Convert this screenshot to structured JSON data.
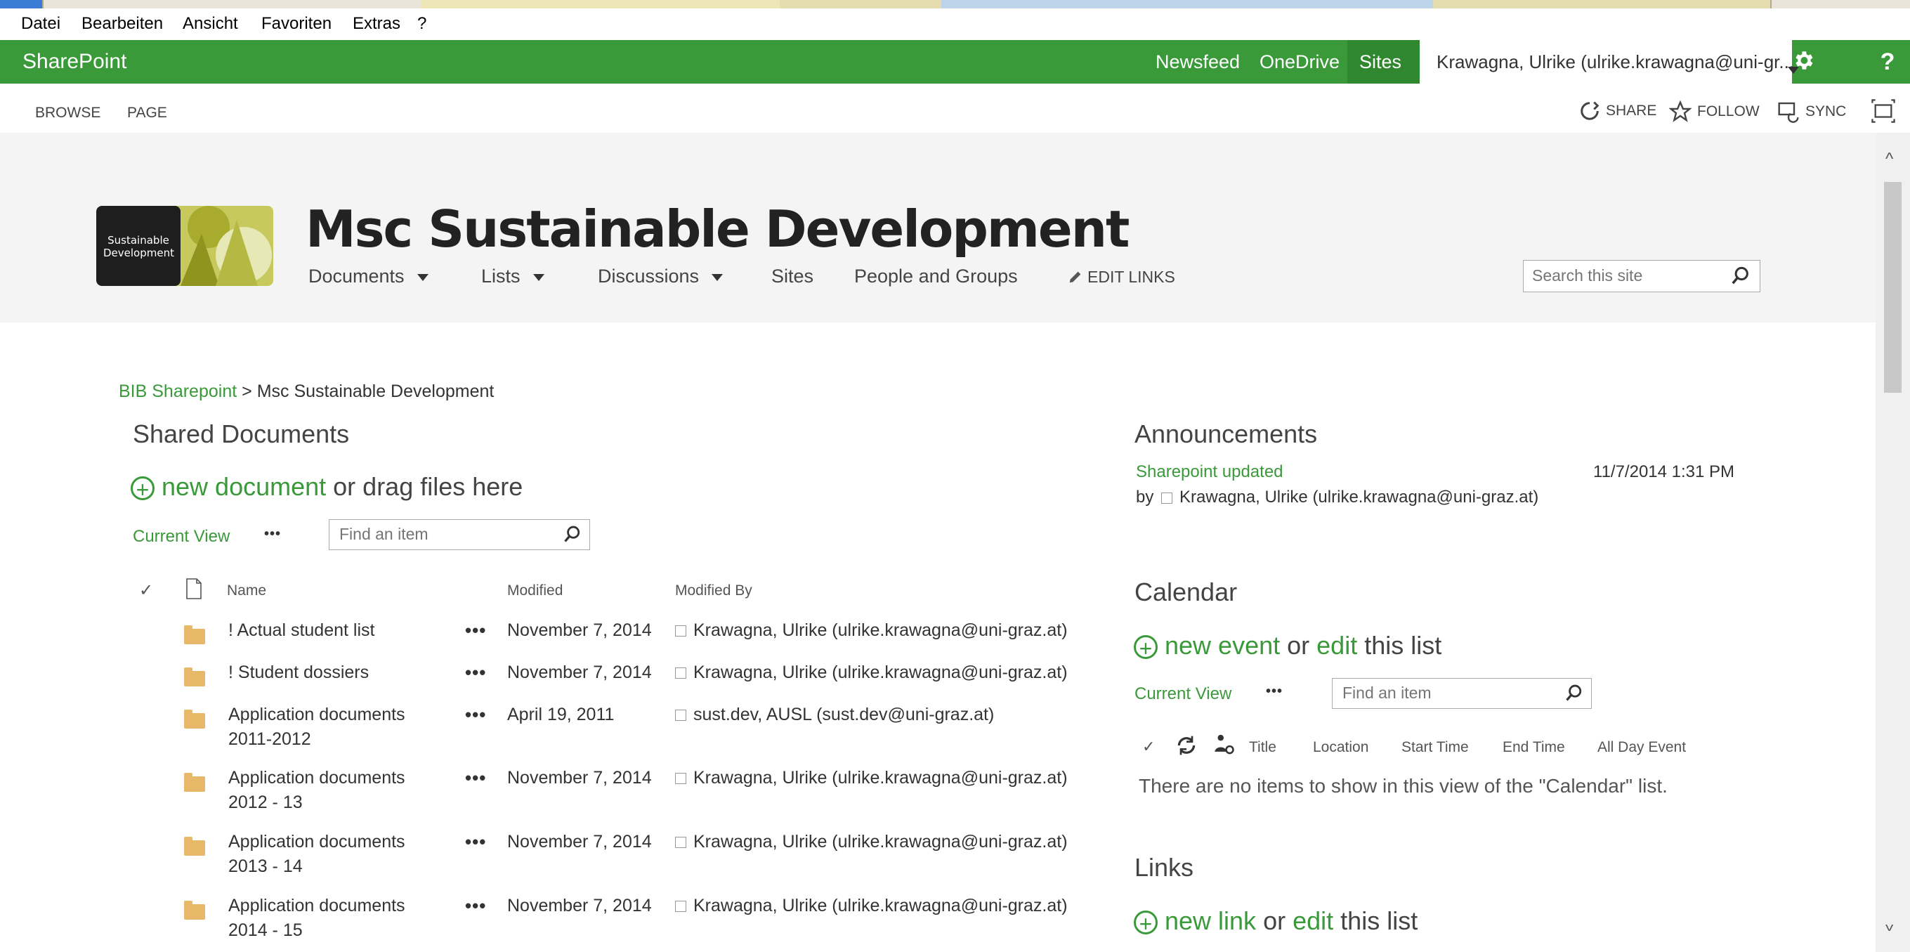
{
  "menubar": {
    "items": [
      "Datei",
      "Bearbeiten",
      "Ansicht",
      "Favoriten",
      "Extras",
      "?"
    ]
  },
  "suitebar": {
    "brand": "SharePoint",
    "nav": [
      "Newsfeed",
      "OneDrive",
      "Sites"
    ],
    "user": "Krawagna, Ulrike (ulrike.krawagna@uni-gr...",
    "settings_icon": "gear-icon",
    "help": "?"
  },
  "ribbon": {
    "tabs": [
      "BROWSE",
      "PAGE"
    ],
    "actions": {
      "share": "SHARE",
      "follow": "FOLLOW",
      "sync": "SYNC"
    }
  },
  "site": {
    "logo_line1": "Sustainable",
    "logo_line2": "Development",
    "title": "Msc Sustainable Development",
    "topnav": [
      "Documents",
      "Lists",
      "Discussions",
      "Sites",
      "People and Groups"
    ],
    "edit_links": "EDIT LINKS",
    "search_placeholder": "Search this site"
  },
  "breadcrumb": {
    "root": "BIB Sharepoint",
    "sep": ">",
    "current": "Msc Sustainable Development"
  },
  "docs": {
    "title": "Shared Documents",
    "new_link": "new document",
    "new_suffix": "or drag files here",
    "current_view": "Current View",
    "more": "•••",
    "find_placeholder": "Find an item",
    "columns": {
      "name": "Name",
      "modified": "Modified",
      "modified_by": "Modified By"
    },
    "rows": [
      {
        "name1": "! Actual student list",
        "name2": "",
        "modified": "November 7, 2014",
        "by": "Krawagna, Ulrike (ulrike.krawagna@uni-graz.at)"
      },
      {
        "name1": "! Student dossiers",
        "name2": "",
        "modified": "November 7, 2014",
        "by": "Krawagna, Ulrike (ulrike.krawagna@uni-graz.at)"
      },
      {
        "name1": "Application documents",
        "name2": "2011-2012",
        "modified": "April 19, 2011",
        "by": "sust.dev, AUSL (sust.dev@uni-graz.at)"
      },
      {
        "name1": "Application documents",
        "name2": "2012 - 13",
        "modified": "November 7, 2014",
        "by": "Krawagna, Ulrike (ulrike.krawagna@uni-graz.at)"
      },
      {
        "name1": "Application documents",
        "name2": "2013 - 14",
        "modified": "November 7, 2014",
        "by": "Krawagna, Ulrike (ulrike.krawagna@uni-graz.at)"
      },
      {
        "name1": "Application documents",
        "name2": "2014 - 15",
        "modified": "November 7, 2014",
        "by": "Krawagna, Ulrike (ulrike.krawagna@uni-graz.at)"
      }
    ]
  },
  "announcements": {
    "title": "Announcements",
    "item_title": "Sharepoint updated",
    "item_date": "11/7/2014 1:31 PM",
    "by_label": "by",
    "by_name": "Krawagna, Ulrike (ulrike.krawagna@uni-graz.at)"
  },
  "calendar": {
    "title": "Calendar",
    "new_link": "new event",
    "or": "or",
    "edit_link": "edit",
    "suffix": "this list",
    "current_view": "Current View",
    "more": "•••",
    "find_placeholder": "Find an item",
    "columns": [
      "Title",
      "Location",
      "Start Time",
      "End Time",
      "All Day Event"
    ],
    "empty": "There are no items to show in this view of the \"Calendar\" list."
  },
  "links": {
    "title": "Links",
    "new_link": "new link",
    "or": "or",
    "edit_link": "edit",
    "suffix": "this list"
  },
  "colors": {
    "suitebar": "#3a9a3a",
    "accent": "#3a9a3a",
    "folder": "#e7b867"
  }
}
